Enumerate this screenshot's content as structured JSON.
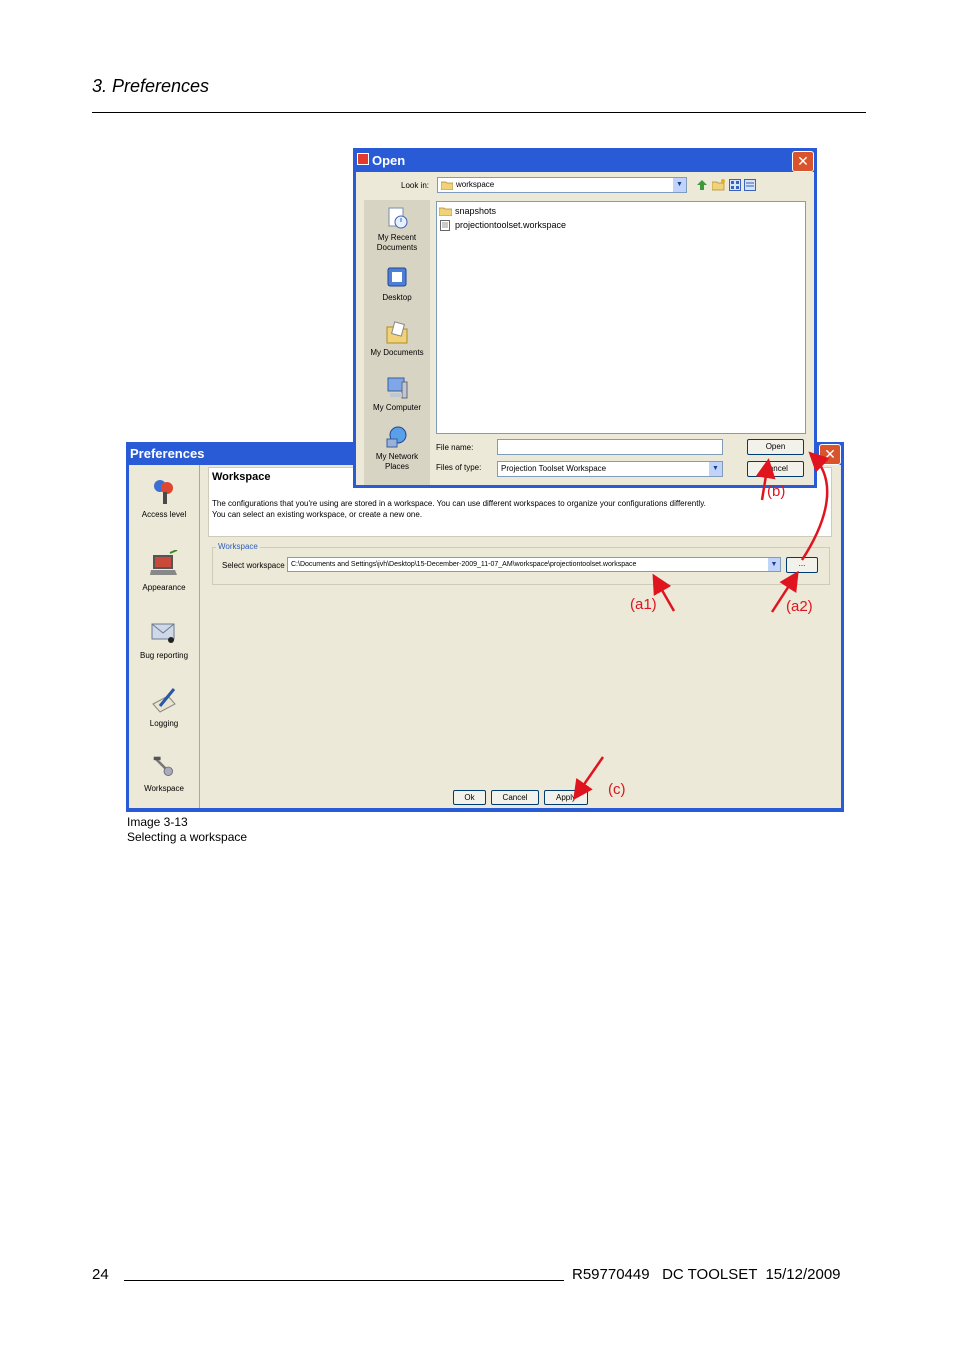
{
  "header": {
    "section_title": "3.  Preferences"
  },
  "preferences_window": {
    "title": "Preferences",
    "sidebar": [
      {
        "label": "Access level",
        "icon": "keys-icon"
      },
      {
        "label": "Appearance",
        "icon": "laptop-paint-icon"
      },
      {
        "label": "Bug reporting",
        "icon": "envelope-bug-icon"
      },
      {
        "label": "Logging",
        "icon": "pen-notepad-icon"
      },
      {
        "label": "Workspace",
        "icon": "tools-icon"
      }
    ],
    "panel_title": "Workspace",
    "description_line1": "The configurations that you're using are stored in a workspace. You can use different workspaces to organize your configurations differently.",
    "description_line2": "You can select an existing workspace, or create a new one.",
    "group_label": "Workspace",
    "select_label": "Select workspace",
    "select_value": "C:\\Documents and Settings\\jvh\\Desktop\\15-December-2009_11-07_AM\\workspace\\projectiontoolset.workspace",
    "browse_label": "...",
    "buttons": {
      "ok": "Ok",
      "cancel": "Cancel",
      "apply": "Apply"
    }
  },
  "open_dialog": {
    "title": "Open",
    "look_in_label": "Look in:",
    "look_in_value": "workspace",
    "places": [
      {
        "label": "My Recent Documents",
        "icon": "recent-documents-icon"
      },
      {
        "label": "Desktop",
        "icon": "desktop-icon"
      },
      {
        "label": "My Documents",
        "icon": "my-documents-icon"
      },
      {
        "label": "My Computer",
        "icon": "my-computer-icon"
      },
      {
        "label": "My Network Places",
        "icon": "network-places-icon"
      }
    ],
    "files": [
      {
        "name": "snapshots",
        "icon": "folder-icon"
      },
      {
        "name": "projectiontoolset.workspace",
        "icon": "file-icon"
      }
    ],
    "file_name_label": "File name:",
    "file_name_value": "",
    "files_of_type_label": "Files of type:",
    "files_of_type_value": "Projection Toolset Workspace",
    "buttons": {
      "open": "Open",
      "cancel": "Cancel"
    }
  },
  "annotations": {
    "a1": "(a1)",
    "a2": "(a2)",
    "b": "(b)",
    "c": "(c)",
    "color": "#e0141e"
  },
  "caption": {
    "line1": "Image 3-13",
    "line2": "Selecting a workspace"
  },
  "footer": {
    "page_number": "24",
    "document": "R59770449   DC TOOLSET  15/12/2009"
  }
}
